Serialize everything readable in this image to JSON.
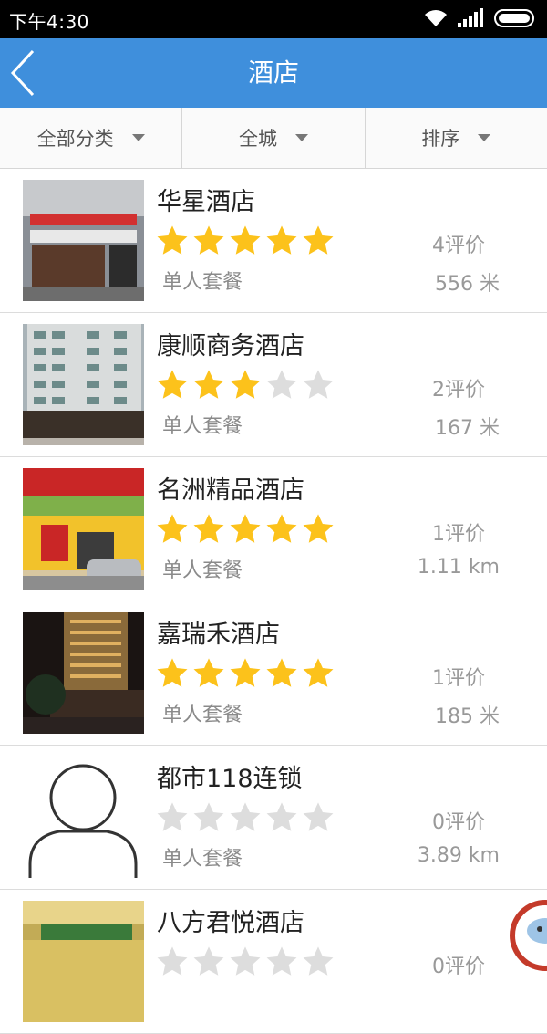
{
  "status_bar": {
    "time": "下午4:30"
  },
  "nav": {
    "title": "酒店"
  },
  "filters": [
    {
      "label": "全部分类"
    },
    {
      "label": "全城"
    },
    {
      "label": "排序"
    }
  ],
  "hotels": [
    {
      "name": "华星酒店",
      "rating": 5,
      "package": "单人套餐",
      "reviews": "4评价",
      "distance": "556 米"
    },
    {
      "name": "康顺商务酒店",
      "rating": 3,
      "package": "单人套餐",
      "reviews": "2评价",
      "distance": "167 米"
    },
    {
      "name": "名洲精品酒店",
      "rating": 5,
      "package": "单人套餐",
      "reviews": "1评价",
      "distance": "1.11 km"
    },
    {
      "name": "嘉瑞禾酒店",
      "rating": 5,
      "package": "单人套餐",
      "reviews": "1评价",
      "distance": "185 米"
    },
    {
      "name": "都市118连锁",
      "rating": 0,
      "package": "单人套餐",
      "reviews": "0评价",
      "distance": "3.89 km"
    },
    {
      "name": "八方君悦酒店",
      "rating": 0,
      "package": "",
      "reviews": "0评价",
      "distance": ""
    }
  ],
  "colors": {
    "nav_bg": "#3f8fdc",
    "star_on": "#fcc21b",
    "star_off": "#dddddd"
  }
}
